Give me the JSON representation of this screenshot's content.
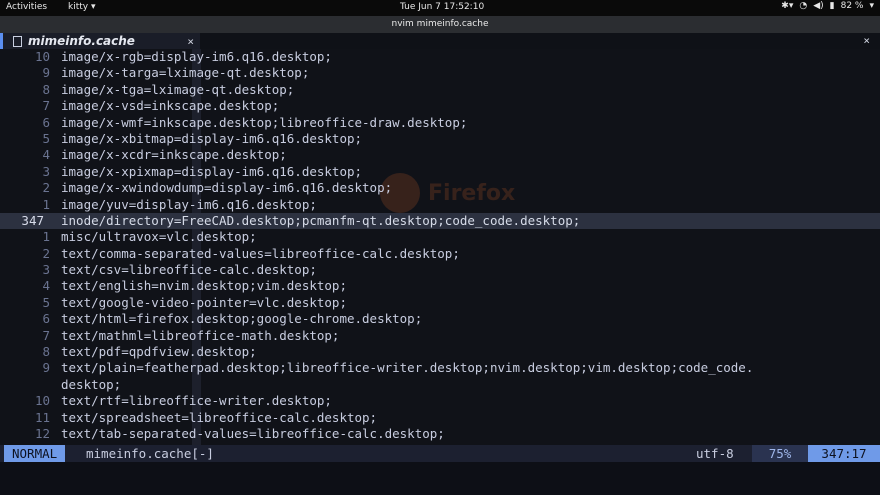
{
  "topbar": {
    "activities": "Activities",
    "app_menu": "kitty ▾",
    "clock": "Tue Jun 7  17:52:10",
    "battery": "82 %"
  },
  "window": {
    "title": "nvim mimeinfo.cache"
  },
  "tab": {
    "name": "mimeinfo.cache",
    "close": "×"
  },
  "closeall": "×",
  "watermark": "Firefox",
  "lines": [
    {
      "num": "10",
      "text": "image/x-rgb=display-im6.q16.desktop;"
    },
    {
      "num": "9",
      "text": "image/x-targa=lximage-qt.desktop;"
    },
    {
      "num": "8",
      "text": "image/x-tga=lximage-qt.desktop;"
    },
    {
      "num": "7",
      "text": "image/x-vsd=inkscape.desktop;"
    },
    {
      "num": "6",
      "text": "image/x-wmf=inkscape.desktop;libreoffice-draw.desktop;"
    },
    {
      "num": "5",
      "text": "image/x-xbitmap=display-im6.q16.desktop;"
    },
    {
      "num": "4",
      "text": "image/x-xcdr=inkscape.desktop;"
    },
    {
      "num": "3",
      "text": "image/x-xpixmap=display-im6.q16.desktop;"
    },
    {
      "num": "2",
      "text": "image/x-xwindowdump=display-im6.q16.desktop;"
    },
    {
      "num": "1",
      "text": "image/yuv=display-im6.q16.desktop;"
    },
    {
      "num": "347",
      "text": "inode/directory=FreeCAD.desktop;pcmanfm-qt.desktop;code_code.desktop;",
      "current": true
    },
    {
      "num": "1",
      "text": "misc/ultravox=vlc.desktop;"
    },
    {
      "num": "2",
      "text": "text/comma-separated-values=libreoffice-calc.desktop;"
    },
    {
      "num": "3",
      "text": "text/csv=libreoffice-calc.desktop;"
    },
    {
      "num": "4",
      "text": "text/english=nvim.desktop;vim.desktop;"
    },
    {
      "num": "5",
      "text": "text/google-video-pointer=vlc.desktop;"
    },
    {
      "num": "6",
      "text": "text/html=firefox.desktop;google-chrome.desktop;"
    },
    {
      "num": "7",
      "text": "text/mathml=libreoffice-math.desktop;"
    },
    {
      "num": "8",
      "text": "text/pdf=qpdfview.desktop;"
    },
    {
      "num": "9",
      "text": "text/plain=featherpad.desktop;libreoffice-writer.desktop;nvim.desktop;vim.desktop;code_code."
    },
    {
      "num": "",
      "text": "desktop;"
    },
    {
      "num": "10",
      "text": "text/rtf=libreoffice-writer.desktop;"
    },
    {
      "num": "11",
      "text": "text/spreadsheet=libreoffice-calc.desktop;"
    },
    {
      "num": "12",
      "text": "text/tab-separated-values=libreoffice-calc.desktop;"
    }
  ],
  "statusline": {
    "mode": "NORMAL",
    "filename": "mimeinfo.cache[-]",
    "encoding": "utf-8",
    "percent": "75%",
    "position": "347:17"
  },
  "colors": {
    "accent": "#6f9ae8",
    "background": "#101218",
    "cursorline": "#2c3140"
  }
}
